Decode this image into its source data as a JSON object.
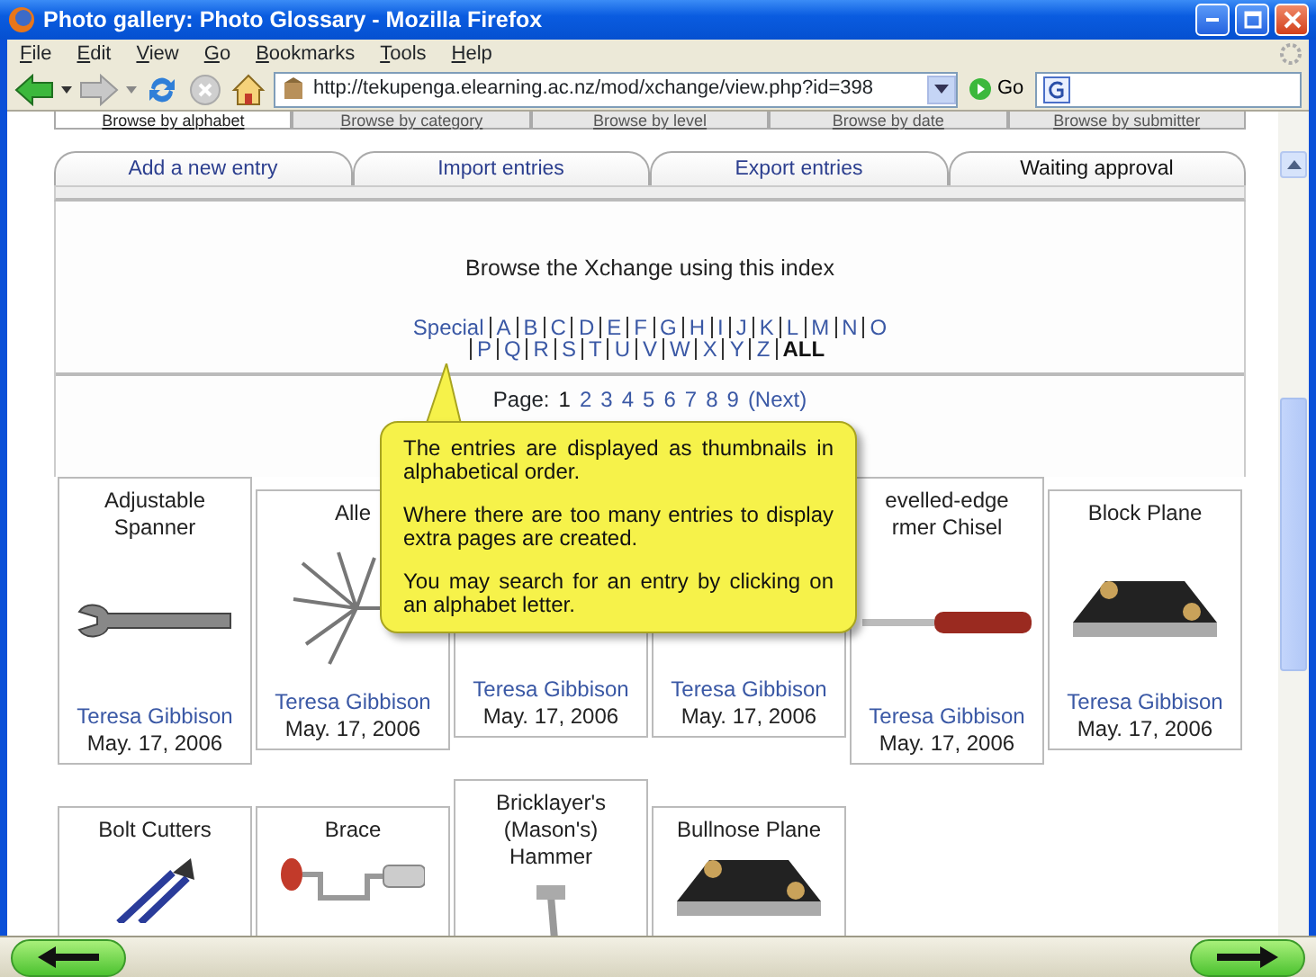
{
  "window": {
    "title": "Photo gallery: Photo Glossary - Mozilla Firefox"
  },
  "menu": [
    "File",
    "Edit",
    "View",
    "Go",
    "Bookmarks",
    "Tools",
    "Help"
  ],
  "toolbar": {
    "url": "http://tekupenga.elearning.ac.nz/mod/xchange/view.php?id=398",
    "go": "Go"
  },
  "browse_tabs": [
    {
      "label": "Browse by alphabet",
      "selected": true
    },
    {
      "label": "Browse by category",
      "selected": false
    },
    {
      "label": "Browse by level",
      "selected": false
    },
    {
      "label": "Browse by date",
      "selected": false
    },
    {
      "label": "Browse by submitter",
      "selected": false
    }
  ],
  "action_tabs": [
    {
      "label": "Add a new entry",
      "selected": false
    },
    {
      "label": "Import entries",
      "selected": false
    },
    {
      "label": "Export entries",
      "selected": false
    },
    {
      "label": "Waiting approval",
      "selected": true
    }
  ],
  "index": {
    "heading": "Browse the Xchange using this index",
    "letters": [
      {
        "label": "Special",
        "selected": false
      },
      {
        "label": "A",
        "selected": false
      },
      {
        "label": "B",
        "selected": false
      },
      {
        "label": "C",
        "selected": false
      },
      {
        "label": "D",
        "selected": false
      },
      {
        "label": "E",
        "selected": false
      },
      {
        "label": "F",
        "selected": false
      },
      {
        "label": "G",
        "selected": false
      },
      {
        "label": "H",
        "selected": false
      },
      {
        "label": "I",
        "selected": false
      },
      {
        "label": "J",
        "selected": false
      },
      {
        "label": "K",
        "selected": false
      },
      {
        "label": "L",
        "selected": false
      },
      {
        "label": "M",
        "selected": false
      },
      {
        "label": "N",
        "selected": false
      },
      {
        "label": "O",
        "selected": false
      },
      {
        "label": "P",
        "selected": false
      },
      {
        "label": "Q",
        "selected": false
      },
      {
        "label": "R",
        "selected": false
      },
      {
        "label": "S",
        "selected": false
      },
      {
        "label": "T",
        "selected": false
      },
      {
        "label": "U",
        "selected": false
      },
      {
        "label": "V",
        "selected": false
      },
      {
        "label": "W",
        "selected": false
      },
      {
        "label": "X",
        "selected": false
      },
      {
        "label": "Y",
        "selected": false
      },
      {
        "label": "Z",
        "selected": false
      },
      {
        "label": "ALL",
        "selected": true
      }
    ]
  },
  "pager": {
    "label": "Page:",
    "pages": [
      {
        "label": "1",
        "selected": true
      },
      {
        "label": "2",
        "selected": false
      },
      {
        "label": "3",
        "selected": false
      },
      {
        "label": "4",
        "selected": false
      },
      {
        "label": "5",
        "selected": false
      },
      {
        "label": "6",
        "selected": false
      },
      {
        "label": "7",
        "selected": false
      },
      {
        "label": "8",
        "selected": false
      },
      {
        "label": "9",
        "selected": false
      }
    ],
    "next": "(Next)"
  },
  "tooltip": {
    "paragraphs": [
      "The entries are displayed as thumbnails in alphabetical order.",
      "Where there are too many entries to display extra pages are created.",
      "You may search for an entry by clicking on an alphabet letter."
    ]
  },
  "entries": [
    [
      {
        "title": "Adjustable Spanner",
        "author": "Teresa Gibbison",
        "date": "May. 17, 2006"
      },
      {
        "title": "Alle",
        "author": "Teresa Gibbison",
        "date": "May. 17, 2006"
      },
      {
        "author": "Teresa Gibbison",
        "date": "May. 17, 2006"
      },
      {
        "author": "Teresa Gibbison",
        "date": "May. 17, 2006"
      },
      {
        "title": "evelled-edge rmer Chisel",
        "author": "Teresa Gibbison",
        "date": "May. 17, 2006"
      },
      {
        "title": "Block Plane",
        "author": "Teresa Gibbison",
        "date": "May. 17, 2006"
      }
    ],
    [
      {
        "title": "Bolt Cutters"
      },
      {
        "title": "Brace"
      },
      {
        "title": "Bricklayer's (Mason's) Hammer"
      },
      {
        "title": "Bullnose Plane"
      }
    ]
  ]
}
